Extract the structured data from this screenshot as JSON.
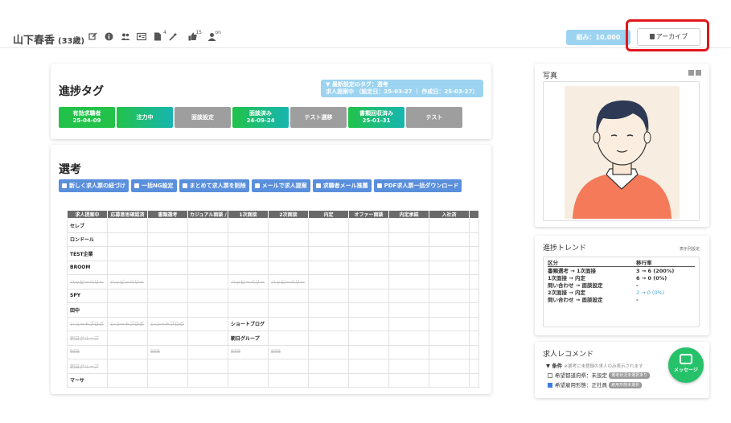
{
  "header": {
    "name": "山下春香",
    "age": "(33歳)",
    "icon_sup_1": "4",
    "icon_sup_2": "15",
    "icon_sup_3": "on",
    "read_badge": "組み：10,000",
    "archive_label": "アーカイブ"
  },
  "progress": {
    "title": "進捗タグ",
    "info_line1": "最新設定のタグ：選考",
    "info_line2": "求人提案中 （設定日：25-03-27 ｜ 作成日：25-03-27）",
    "tags": [
      {
        "label": "有効求職者",
        "date": "25-04-09",
        "style": "g"
      },
      {
        "label": "注力中",
        "date": "",
        "style": "gt"
      },
      {
        "label": "面談設定",
        "date": "",
        "style": "gr"
      },
      {
        "label": "面談済み",
        "date": "24-09-24",
        "style": "gt"
      },
      {
        "label": "テスト選移",
        "date": "",
        "style": "gr"
      },
      {
        "label": "書類回収済み",
        "date": "25-01-31",
        "style": "gt"
      },
      {
        "label": "テスト",
        "date": "",
        "style": "gr"
      }
    ]
  },
  "selection": {
    "title": "選考",
    "buttons": [
      "新しく求人票の紐づけ",
      "一括NG設定",
      "まとめて求人票を削除",
      "メールで求人提案",
      "求職者メール推薦",
      "PDF求人票一括ダウンロード"
    ],
    "columns": [
      "求人提案中",
      "応募意思確認済",
      "書類選考",
      "カジュアル面談 /",
      "1次面接",
      "2次面接",
      "内定",
      "オファー面談",
      "内定承諾",
      "入社済"
    ],
    "rows": [
      {
        "cells": [
          "セレブ",
          "",
          "",
          "",
          "",
          "",
          "",
          "",
          "",
          ""
        ],
        "strike": []
      },
      {
        "cells": [
          "ロンドール",
          "",
          "",
          "",
          "",
          "",
          "",
          "",
          "",
          ""
        ],
        "strike": []
      },
      {
        "cells": [
          "TEST企業",
          "",
          "",
          "",
          "",
          "",
          "",
          "",
          "",
          ""
        ],
        "strike": []
      },
      {
        "cells": [
          "BROOM",
          "",
          "",
          "",
          "",
          "",
          "",
          "",
          "",
          ""
        ],
        "strike": []
      },
      {
        "cells": [
          "ハッピーペリー",
          "ハッピーペリー",
          "",
          "",
          "ハッピーペリー",
          "ハッピーペリー",
          "",
          "",
          "",
          ""
        ],
        "strike": [
          0,
          1,
          4,
          5
        ]
      },
      {
        "cells": [
          "SPY",
          "",
          "",
          "",
          "",
          "",
          "",
          "",
          "",
          ""
        ],
        "strike": []
      },
      {
        "cells": [
          "田中",
          "",
          "",
          "",
          "",
          "",
          "",
          "",
          "",
          ""
        ],
        "strike": []
      },
      {
        "cells": [
          "ショートブログ",
          "ショートブログ",
          "ショートブログ",
          "",
          "ショートブログ",
          "",
          "",
          "",
          "",
          ""
        ],
        "strike": [
          0,
          1,
          2
        ]
      },
      {
        "cells": [
          "朝日グループ",
          "",
          "",
          "",
          "朝日グループ",
          "",
          "",
          "",
          "",
          ""
        ],
        "strike": [
          0
        ]
      },
      {
        "cells": [
          "BEB",
          "",
          "BEB",
          "",
          "BEB",
          "BEB",
          "",
          "",
          "",
          ""
        ],
        "strike": [
          0,
          2,
          4,
          5
        ]
      },
      {
        "cells": [
          "朝日グループ",
          "",
          "",
          "",
          "",
          "",
          "",
          "",
          "",
          ""
        ],
        "strike": [
          0
        ]
      },
      {
        "cells": [
          "マーサ",
          "",
          "",
          "",
          "",
          "",
          "",
          "",
          "",
          ""
        ],
        "strike": []
      }
    ]
  },
  "photo": {
    "title": "写真"
  },
  "trend": {
    "title": "進捗トレンド",
    "link": "表示列設定",
    "head_k": "区分",
    "head_v": "移行率",
    "rows": [
      {
        "k": "書類選考 → 1次面接",
        "v": "3 → 6 (200%)",
        "blue": false
      },
      {
        "k": "1次面接 → 内定",
        "v": "6 → 0 (0%)",
        "blue": false
      },
      {
        "k": "問い合わせ → 面談設定",
        "v": "-",
        "blue": false
      },
      {
        "k": "2次面接 → 内定",
        "v": "2 → 0 (0%)",
        "blue": true
      },
      {
        "k": "問い合わせ → 面談設定",
        "v": "-",
        "blue": false
      }
    ]
  },
  "recommend": {
    "title": "求人レコメンド",
    "cond": "▼ 条件",
    "cond_note": "※選考に未登録の求人のみ表示されます",
    "row1_label": "希望都道府県：",
    "row1_value": "未設定",
    "row1_chip": "選考状況未選択あり",
    "row2_label": "希望雇用形態：",
    "row2_value": "正社員",
    "row2_chip": "雇用形態未選択"
  },
  "message_btn": "メッセージ",
  "colors": {
    "accent_green": "#22c24a",
    "info_blue": "#9cd3f0",
    "button_blue": "#5a8fdc",
    "highlight_red": "#e0161b"
  }
}
